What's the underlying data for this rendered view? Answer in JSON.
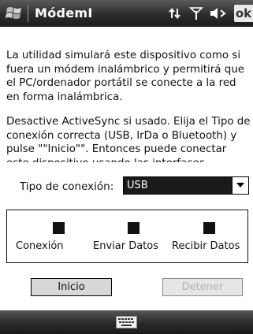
{
  "window": {
    "title": "MódemI"
  },
  "status_bar": {
    "icons": [
      "windows-start-icon",
      "connectivity-icon",
      "signal-icon",
      "volume-icon"
    ],
    "ok_label": "ok"
  },
  "content": {
    "paragraph1": "La utilidad simulará este dispositivo como si fuera un módem inalámbrico y permitirá que el PC/ordenador portátil se conecte a la red en forma inalámbrica.",
    "paragraph2": "Desactive ActiveSync si usado. Elija el Tipo de conexión correcta (USB, IrDa o Bluetooth) y pulse \"\"Inicio\"\". Entonces puede conectar este dispositivo usando las interfaces"
  },
  "connection": {
    "label": "Tipo de conexión:",
    "selected": "USB"
  },
  "indicators": [
    {
      "label": "Conexión"
    },
    {
      "label": "Enviar Datos"
    },
    {
      "label": "Recibir Datos"
    }
  ],
  "buttons": {
    "start": "Inicio",
    "stop": "Detener"
  },
  "colors": {
    "title_bar": "#2c2c2c",
    "select_bg": "#1a1a1a",
    "disabled_text": "#b4b4b4"
  }
}
